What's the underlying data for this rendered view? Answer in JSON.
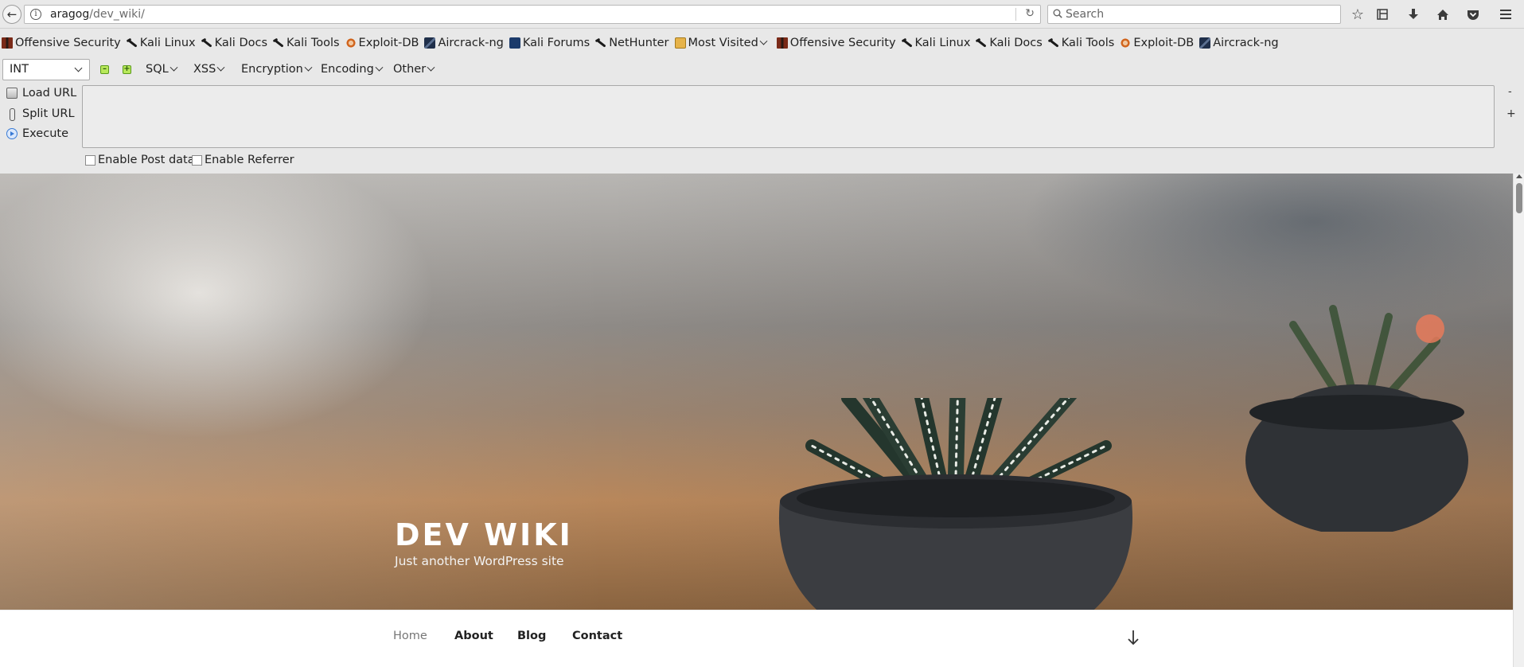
{
  "browser": {
    "url_host": "aragog",
    "url_path": "/dev_wiki/",
    "search_placeholder": "Search"
  },
  "bookmarks": [
    {
      "label": "Offensive Security",
      "icon": "offensive-security-icon"
    },
    {
      "label": "Kali Linux",
      "icon": "kali-dragon-icon"
    },
    {
      "label": "Kali Docs",
      "icon": "kali-dragon-icon"
    },
    {
      "label": "Kali Tools",
      "icon": "kali-dragon-icon"
    },
    {
      "label": "Exploit-DB",
      "icon": "exploit-db-icon"
    },
    {
      "label": "Aircrack-ng",
      "icon": "aircrack-icon"
    },
    {
      "label": "Kali Forums",
      "icon": "kali-forums-icon"
    },
    {
      "label": "NetHunter",
      "icon": "kali-dragon-icon"
    },
    {
      "label": "Most Visited",
      "icon": "folder-icon"
    },
    {
      "label": "Offensive Security",
      "icon": "offensive-security-icon"
    },
    {
      "label": "Kali Linux",
      "icon": "kali-dragon-icon"
    },
    {
      "label": "Kali Docs",
      "icon": "kali-dragon-icon"
    },
    {
      "label": "Kali Tools",
      "icon": "kali-dragon-icon"
    },
    {
      "label": "Exploit-DB",
      "icon": "exploit-db-icon"
    },
    {
      "label": "Aircrack-ng",
      "icon": "aircrack-icon"
    }
  ],
  "hackbar": {
    "type_select": "INT",
    "menus": {
      "sql": "SQL",
      "xss": "XSS",
      "encryption": "Encryption",
      "encoding": "Encoding",
      "other": "Other"
    },
    "actions": {
      "load_url": "Load URL",
      "split_url": "Split URL",
      "execute": "Execute"
    },
    "textarea_value": "",
    "checkboxes": {
      "post_data": "Enable Post data",
      "referrer": "Enable Referrer"
    },
    "side_minus": "-",
    "side_plus": "+"
  },
  "site": {
    "title": "DEV WIKI",
    "description": "Just another WordPress site",
    "menu": {
      "home": "Home",
      "about": "About",
      "blog": "Blog",
      "contact": "Contact"
    }
  }
}
